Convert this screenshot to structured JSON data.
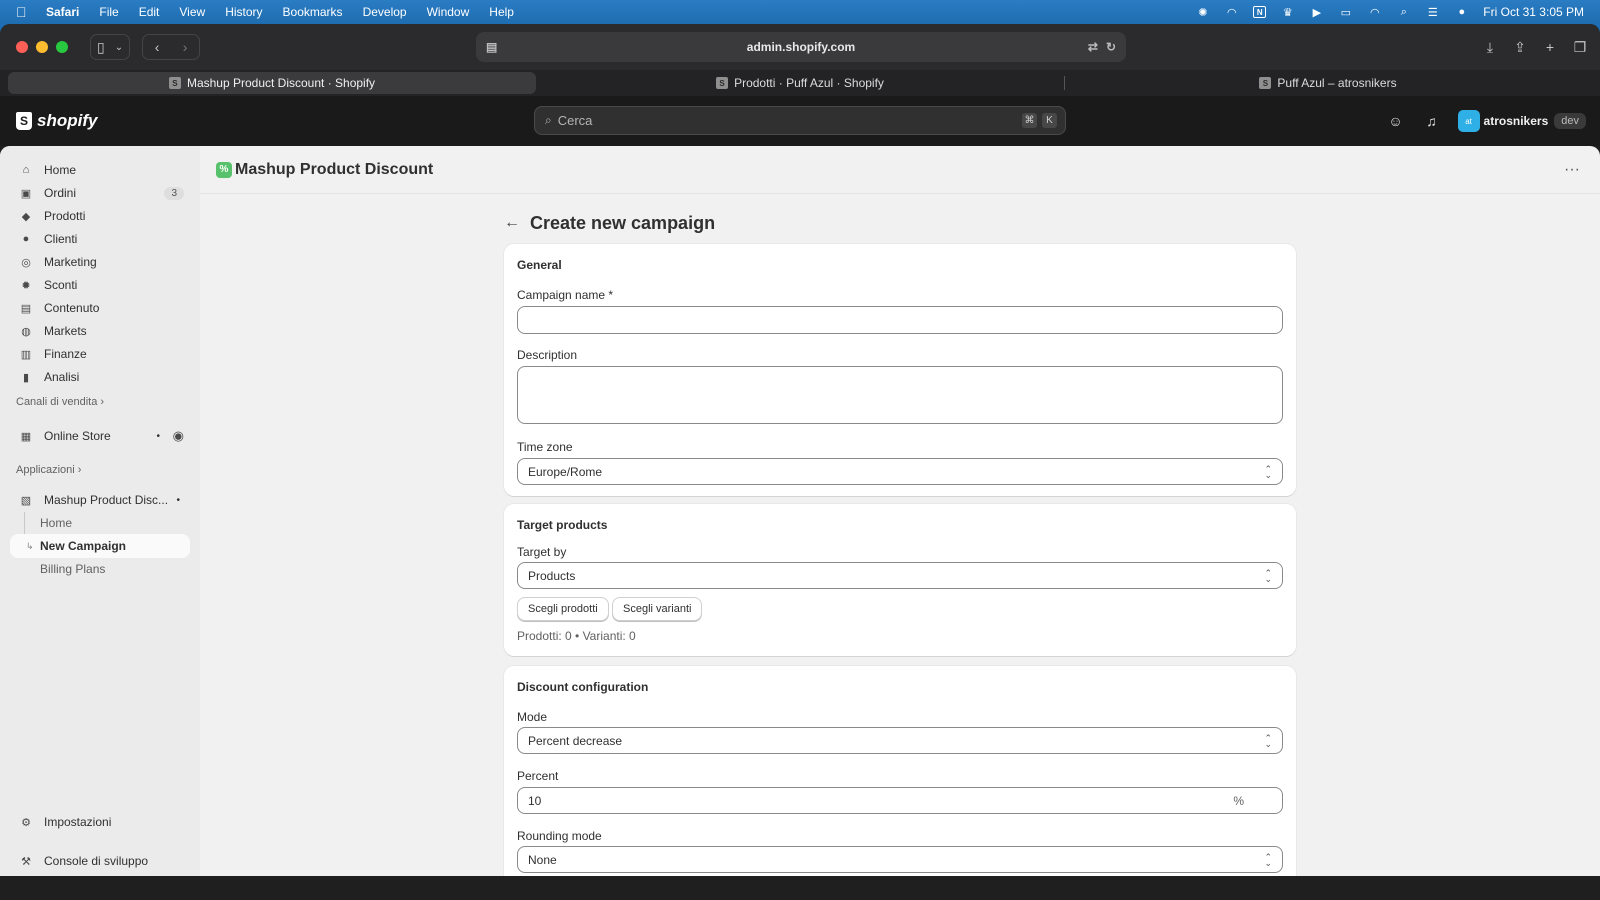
{
  "menubar": {
    "items": [
      "Safari",
      "File",
      "Edit",
      "View",
      "History",
      "Bookmarks",
      "Develop",
      "Window",
      "Help"
    ],
    "clock": "Fri Oct 31  3:05 PM"
  },
  "browser": {
    "address": "admin.shopify.com",
    "tabs": [
      {
        "label": "Mashup Product Discount · Shopify",
        "active": true
      },
      {
        "label": "Prodotti · Puff Azul · Shopify",
        "active": false
      },
      {
        "label": "Puff Azul – atrosnikers",
        "active": false
      }
    ]
  },
  "shopify": {
    "logo": "shopify",
    "search_placeholder": "Cerca",
    "kbd1": "⌘",
    "kbd2": "K",
    "avatar_initials": "at",
    "username": "atrosnikers",
    "env_badge": "dev"
  },
  "sidebar": {
    "items": [
      {
        "label": "Home",
        "icon": "home-icon"
      },
      {
        "label": "Ordini",
        "icon": "orders-icon",
        "badge": "3"
      },
      {
        "label": "Prodotti",
        "icon": "tag-icon"
      },
      {
        "label": "Clienti",
        "icon": "person-icon"
      },
      {
        "label": "Marketing",
        "icon": "target-icon"
      },
      {
        "label": "Sconti",
        "icon": "discount-icon"
      },
      {
        "label": "Contenuto",
        "icon": "content-icon"
      },
      {
        "label": "Markets",
        "icon": "globe-icon"
      },
      {
        "label": "Finanze",
        "icon": "bank-icon"
      },
      {
        "label": "Analisi",
        "icon": "chart-icon"
      }
    ],
    "sales_channels_label": "Canali di vendita",
    "online_store": "Online Store",
    "apps_label": "Applicazioni",
    "app_name": "Mashup Product Disc...",
    "app_sub": [
      "Home",
      "New Campaign",
      "Billing Plans"
    ],
    "settings": "Impostazioni",
    "dev_console": "Console di sviluppo"
  },
  "page": {
    "app_title": "Mashup Product Discount",
    "heading": "Create new campaign"
  },
  "general": {
    "title": "General",
    "campaign_name_label": "Campaign name *",
    "campaign_name_value": "",
    "description_label": "Description",
    "description_value": "",
    "timezone_label": "Time zone",
    "timezone_value": "Europe/Rome"
  },
  "target": {
    "title": "Target products",
    "target_by_label": "Target by",
    "target_by_value": "Products",
    "choose_products": "Scegli prodotti",
    "choose_variants": "Scegli varianti",
    "summary": "Prodotti: 0 • Varianti: 0"
  },
  "discount": {
    "title": "Discount configuration",
    "mode_label": "Mode",
    "mode_value": "Percent decrease",
    "percent_label": "Percent",
    "percent_value": "10",
    "percent_suffix": "%",
    "rounding_label": "Rounding mode",
    "rounding_value": "None"
  }
}
